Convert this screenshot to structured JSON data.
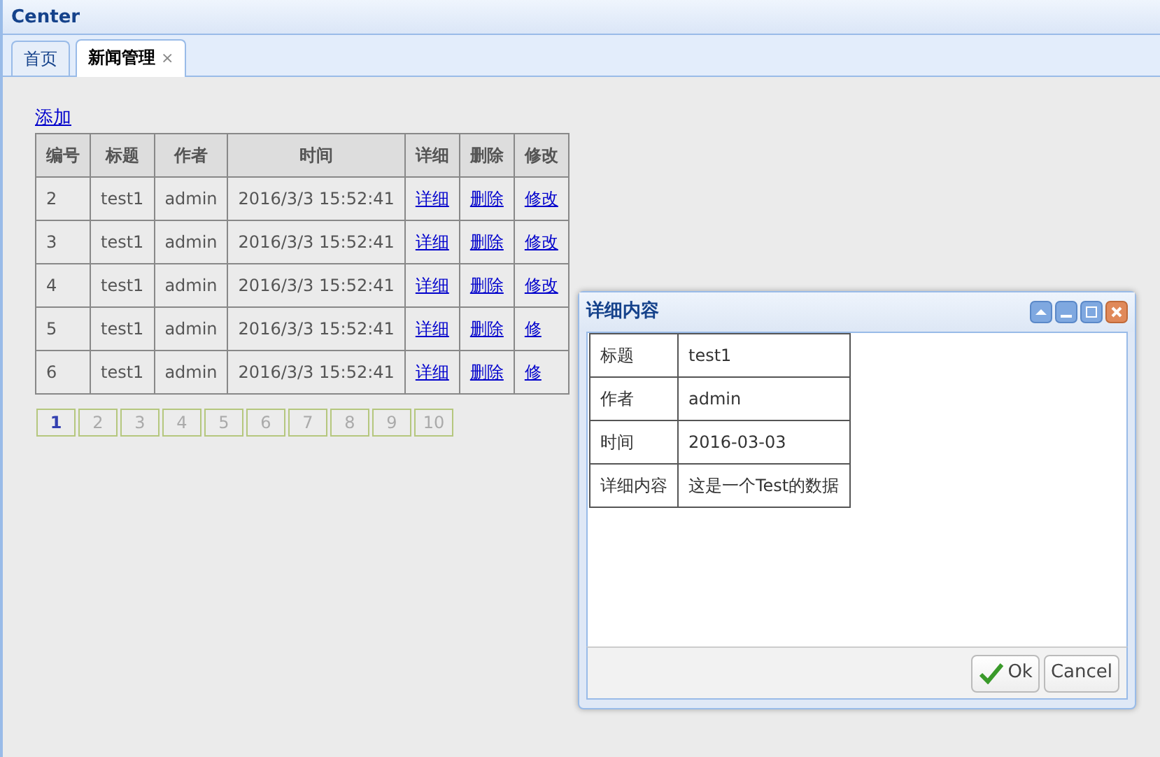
{
  "window": {
    "title": "Center"
  },
  "tabs": [
    {
      "label": "首页",
      "selected": false,
      "closable": false
    },
    {
      "label": "新闻管理",
      "selected": true,
      "closable": true,
      "close_glyph": "×"
    }
  ],
  "add_link": "添加",
  "table": {
    "columns": [
      "编号",
      "标题",
      "作者",
      "时间",
      "详细",
      "删除",
      "修改"
    ],
    "rows": [
      [
        "2",
        "test1",
        "admin",
        "2016/3/3 15:52:41",
        "详细",
        "删除",
        "修改"
      ],
      [
        "3",
        "test1",
        "admin",
        "2016/3/3 15:52:41",
        "详细",
        "删除",
        "修改"
      ],
      [
        "4",
        "test1",
        "admin",
        "2016/3/3 15:52:41",
        "详细",
        "删除",
        "修改"
      ],
      [
        "5",
        "test1",
        "admin",
        "2016/3/3 15:52:41",
        "详细",
        "删除",
        "修"
      ],
      [
        "6",
        "test1",
        "admin",
        "2016/3/3 15:52:41",
        "详细",
        "删除",
        "修"
      ]
    ]
  },
  "pagination": [
    {
      "label": "1",
      "selected": true
    },
    {
      "label": "2",
      "selected": false
    },
    {
      "label": "3",
      "selected": false
    },
    {
      "label": "4",
      "selected": false
    },
    {
      "label": "5",
      "selected": false
    },
    {
      "label": "6",
      "selected": false
    },
    {
      "label": "7",
      "selected": false
    },
    {
      "label": "8",
      "selected": false
    },
    {
      "label": "9",
      "selected": false
    },
    {
      "label": "10",
      "selected": false
    }
  ],
  "dialog": {
    "title": "详细内容",
    "fields": [
      {
        "label": "标题",
        "value": "test1"
      },
      {
        "label": "作者",
        "value": "admin"
      },
      {
        "label": "时间",
        "value": "2016-03-03"
      },
      {
        "label": "详细内容",
        "value": "这是一个Test的数据"
      }
    ],
    "buttons": [
      {
        "label": "Ok",
        "kind": "ok"
      },
      {
        "label": "Cancel",
        "kind": "cancel"
      }
    ]
  }
}
